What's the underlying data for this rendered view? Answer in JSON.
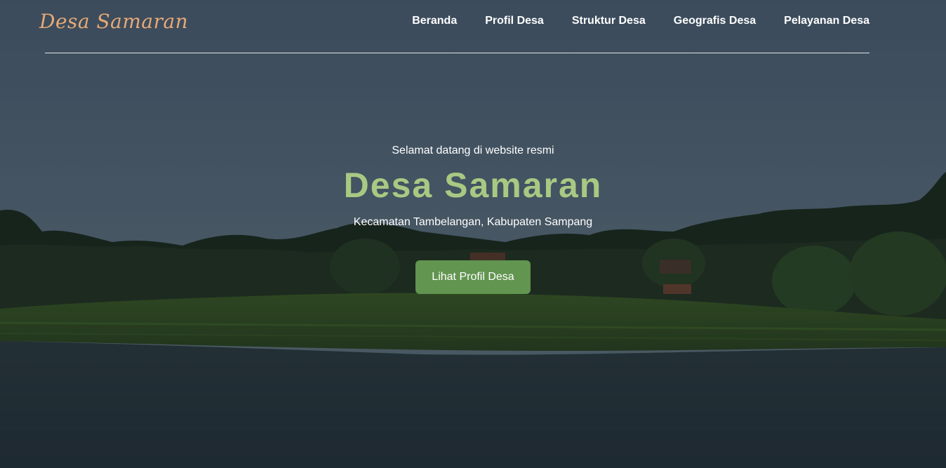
{
  "brand": {
    "name": "Desa Samaran"
  },
  "nav": {
    "items": [
      {
        "label": "Beranda"
      },
      {
        "label": "Profil Desa"
      },
      {
        "label": "Struktur Desa"
      },
      {
        "label": "Geografis Desa"
      },
      {
        "label": "Pelayanan Desa"
      }
    ]
  },
  "hero": {
    "welcome": "Selamat datang di website resmi",
    "title": "Desa Samaran",
    "subtitle": "Kecamatan Tambelangan, Kabupaten Sampang",
    "cta_label": "Lihat Profil Desa"
  },
  "colors": {
    "brand": "#e7a977",
    "title_accent": "#a8c983",
    "cta_background": "#619550",
    "nav_text": "#ffffff"
  }
}
